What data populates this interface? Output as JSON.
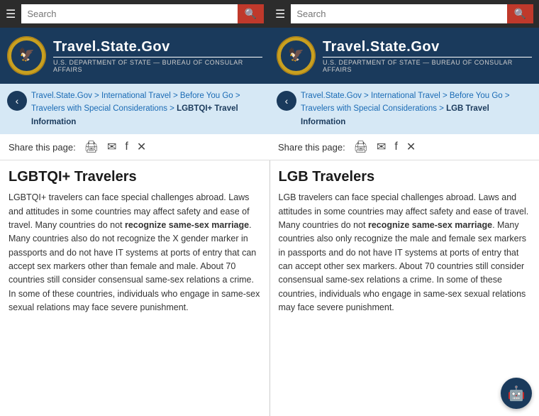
{
  "left": {
    "search_placeholder": "Search",
    "header_title": "Travel.State.Gov",
    "header_subtitle": "U.S. DEPARTMENT of STATE — BUREAU of CONSULAR AFFAIRS",
    "breadcrumb": {
      "parts": [
        "Travel.State.Gov",
        "International Travel",
        "Before You Go",
        "Travelers with Special Considerations"
      ],
      "current": "LGBTQI+ Travel Information"
    },
    "share_label": "Share this page:",
    "content_title": "LGBTQI+ Travelers",
    "content_body_before": "LGBTQI+ travelers can face special challenges abroad. Laws and attitudes in some countries may affect safety and ease of travel. Many countries do not ",
    "content_bold": "recognize same-sex marriage",
    "content_body_after": ". Many countries also do not recognize the X gender marker in passports and do not have IT systems at ports of entry that can accept sex markers other than female and male. About 70 countries still consider consensual same-sex relations a crime. In some of these countries, individuals who engage in same-sex sexual relations may face severe punishment."
  },
  "right": {
    "search_placeholder": "Search",
    "header_title": "Travel.State.Gov",
    "header_subtitle": "U.S. DEPARTMENT of STATE — BUREAU of CONSULAR AFFAIRS",
    "breadcrumb": {
      "parts": [
        "Travel.State.Gov",
        "International Travel",
        "Before You Go",
        "Travelers with Special Considerations"
      ],
      "current": "LGB Travel Information"
    },
    "share_label": "Share this page:",
    "content_title": "LGB Travelers",
    "content_body_before": "LGB travelers can face special challenges abroad. Laws and attitudes in some countries may affect safety and ease of travel. Many countries do not ",
    "content_bold": "recognize same-sex marriage",
    "content_body_after": ". Many countries also only recognize the male and female sex markers in passports and do not have IT systems at ports of entry that can accept other sex markers. About 70 countries still consider consensual same-sex relations a crime. In some of these countries, individuals who engage in same-sex sexual relations may face severe punishment."
  },
  "chatbot_icon": "🤖"
}
